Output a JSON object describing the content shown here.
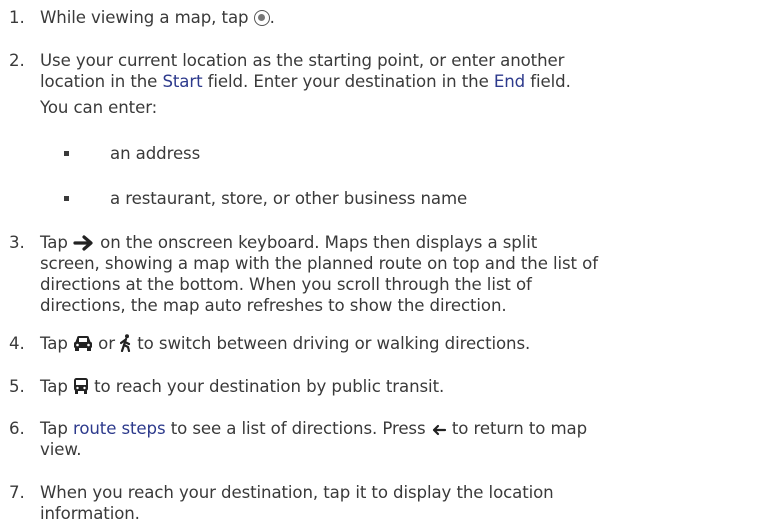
{
  "steps": [
    {
      "num": "1.",
      "a": "While viewing a map, tap ",
      "icon": "directions-icon",
      "b": "."
    },
    {
      "num": "2.",
      "line1a": "Use your current location as the starting point, or enter another",
      "line2a": "location in the ",
      "start": "Start",
      "line2b": " field. Enter your destination in the ",
      "end": "End",
      "line2c": " field.",
      "sub": "You can enter:"
    },
    {
      "num": "3.",
      "a": "Tap ",
      "icon": "arrow-right-icon",
      "b": " on the onscreen keyboard. Maps then displays a split",
      "line2": "screen, showing a map with the planned route on top and the list of",
      "line3": "directions at the bottom. When you scroll through the list of",
      "line4": "directions, the map auto refreshes to show the direction."
    },
    {
      "num": "4.",
      "a": "Tap ",
      "icon1": "car-icon",
      "mid": " or ",
      "icon2": "walk-icon",
      "b": " to switch between driving or walking directions."
    },
    {
      "num": "5.",
      "a": "Tap ",
      "icon": "bus-icon",
      "b": " to reach your destination by public transit."
    },
    {
      "num": "6.",
      "a": "Tap ",
      "link": "route steps",
      "b": " to see a list of directions. Press ",
      "icon": "back-arrow-icon",
      "c": " to return to map",
      "line2": "view."
    },
    {
      "num": "7.",
      "line1": "When you reach your destination, tap it to display the location",
      "line2": "information."
    }
  ],
  "bullets": [
    "an address",
    "a restaurant, store, or other business name"
  ]
}
